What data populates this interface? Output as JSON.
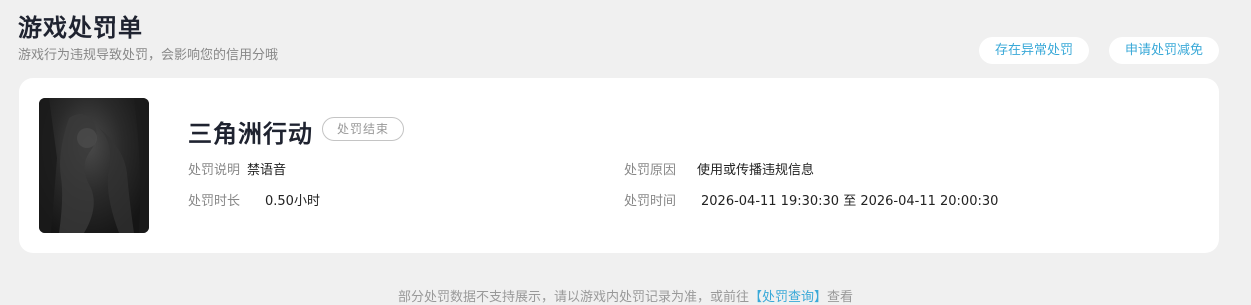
{
  "header": {
    "title": "游戏处罚单",
    "subtitle": "游戏行为违规导致处罚，会影响您的信用分哦"
  },
  "actions": {
    "abnormal_label": "存在异常处罚",
    "reduce_label": "申请处罚减免"
  },
  "record": {
    "game_name": "三角洲行动",
    "status": "处罚结束",
    "description_label": "处罚说明",
    "description_value": "禁语音",
    "reason_label": "处罚原因",
    "reason_value": "使用或传播违规信息",
    "duration_label": "处罚时长",
    "duration_value": "0.50小时",
    "time_label": "处罚时间",
    "time_value": "2026-04-11 19:30:30 至 2026-04-11 20:00:30"
  },
  "footer": {
    "note_before": "部分处罚数据不支持展示，请以游戏内处罚记录为准，或前往",
    "link_label": "【处罚查询】",
    "note_after": "查看"
  },
  "colors": {
    "accent": "#3aa9d8",
    "background": "#f0f0f0"
  }
}
